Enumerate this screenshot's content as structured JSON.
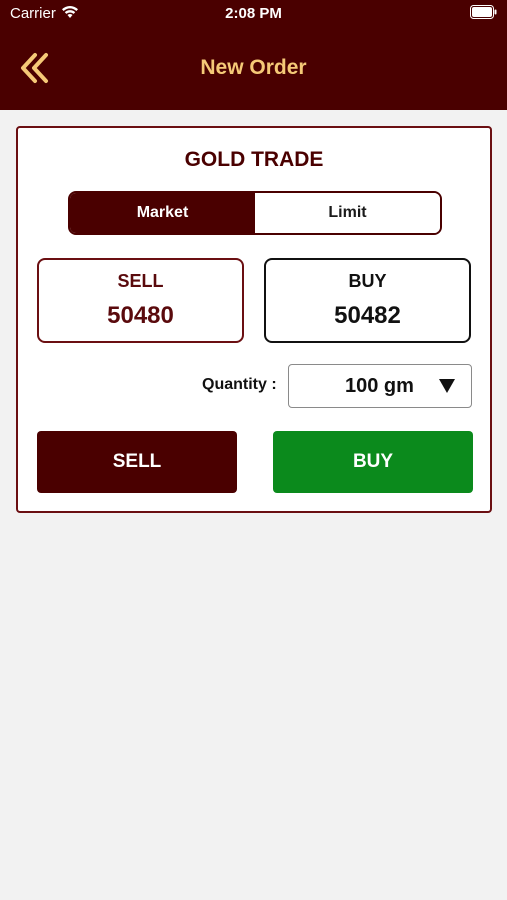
{
  "status_bar": {
    "carrier": "Carrier",
    "time": "2:08 PM"
  },
  "header": {
    "title": "New Order",
    "back_icon": "double-chevron-left-icon",
    "title_color": "#f5c977",
    "background": "#4a0000"
  },
  "trade_card": {
    "title": "GOLD TRADE",
    "order_types": [
      {
        "label": "Market",
        "selected": true
      },
      {
        "label": "Limit",
        "selected": false
      }
    ],
    "sell_price": {
      "label": "SELL",
      "value": "50480"
    },
    "buy_price": {
      "label": "BUY",
      "value": "50482"
    },
    "quantity": {
      "label": "Quantity :",
      "value": "100 gm"
    },
    "actions": {
      "sell_label": "SELL",
      "buy_label": "BUY",
      "sell_color": "#4a0000",
      "buy_color": "#0b8a1c"
    }
  }
}
